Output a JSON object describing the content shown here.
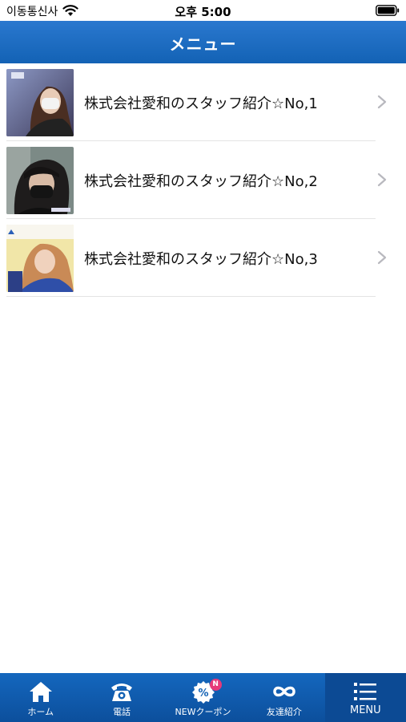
{
  "status_bar": {
    "carrier": "이동통신사",
    "time": "오후 5:00"
  },
  "nav": {
    "title": "メニュー"
  },
  "items": [
    {
      "label": "株式会社愛和のスタッフ紹介☆No,1"
    },
    {
      "label": "株式会社愛和のスタッフ紹介☆No,2"
    },
    {
      "label": "株式会社愛和のスタッフ紹介☆No,3"
    }
  ],
  "tabs": [
    {
      "label": "ホーム",
      "icon": "home-icon"
    },
    {
      "label": "電話",
      "icon": "phone-icon"
    },
    {
      "label": "NEWクーポン",
      "icon": "coupon-icon",
      "badge": "N"
    },
    {
      "label": "友達紹介",
      "icon": "infinity-icon"
    },
    {
      "label": "MENU",
      "icon": "menu-icon"
    }
  ],
  "colors": {
    "header": "#1a6ac4",
    "tab_bar": "#0f58a8",
    "badge": "#e6397a"
  }
}
